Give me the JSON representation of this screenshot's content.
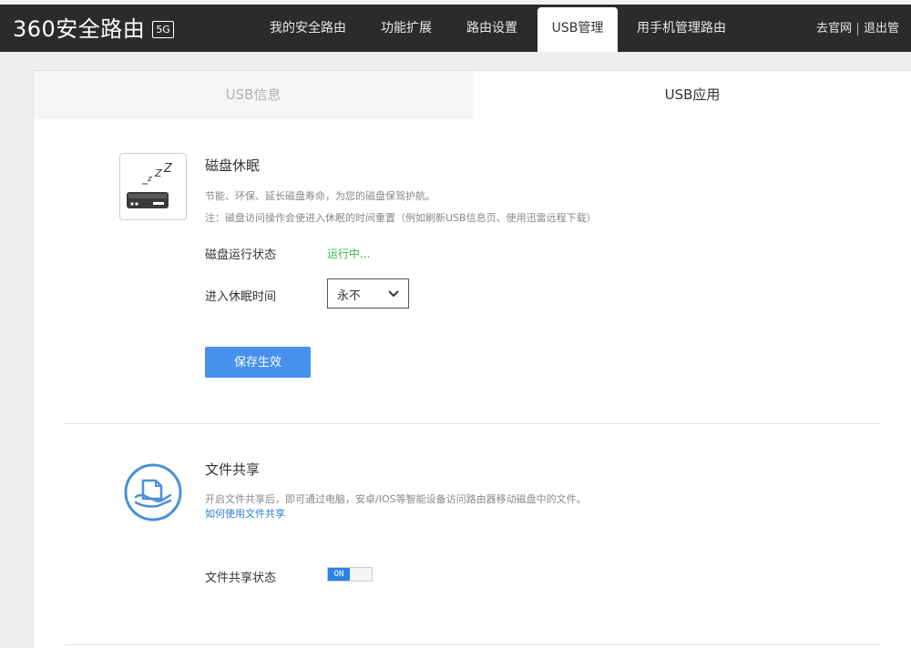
{
  "header": {
    "logo_text": "360安全路由",
    "logo_badge": "5G",
    "nav": [
      {
        "label": "我的安全路由"
      },
      {
        "label": "功能扩展"
      },
      {
        "label": "路由设置"
      },
      {
        "label": "USB管理"
      },
      {
        "label": "用手机管理路由"
      }
    ],
    "right_links": {
      "official": "去官网",
      "logout": "退出管"
    }
  },
  "tabs": [
    {
      "label": "USB信息"
    },
    {
      "label": "USB应用"
    }
  ],
  "disk_sleep": {
    "title": "磁盘休眠",
    "desc": "节能、环保、延长磁盘寿命，为您的磁盘保驾护航。",
    "note": "注：磁盘访问操作会使进入休眠的时间重置（例如刷新USB信息页、使用迅雷远程下载）",
    "status_label": "磁盘运行状态",
    "status_value": "运行中...",
    "sleep_time_label": "进入休眠时间",
    "sleep_time_value": "永不",
    "save_label": "保存生效",
    "icon_text": "ZZZ"
  },
  "file_share": {
    "title": "文件共享",
    "desc": "开启文件共享后，即可通过电脑，安卓/IOS等智能设备访问路由器移动磁盘中的文件。",
    "link": "如何使用文件共享",
    "status_label": "文件共享状态",
    "toggle_label": "ON"
  },
  "colors": {
    "header_bg": "#2b2b2b",
    "accent_blue": "#4790ec",
    "running_green": "#3bb84a",
    "link_blue": "#2f7fd6"
  }
}
